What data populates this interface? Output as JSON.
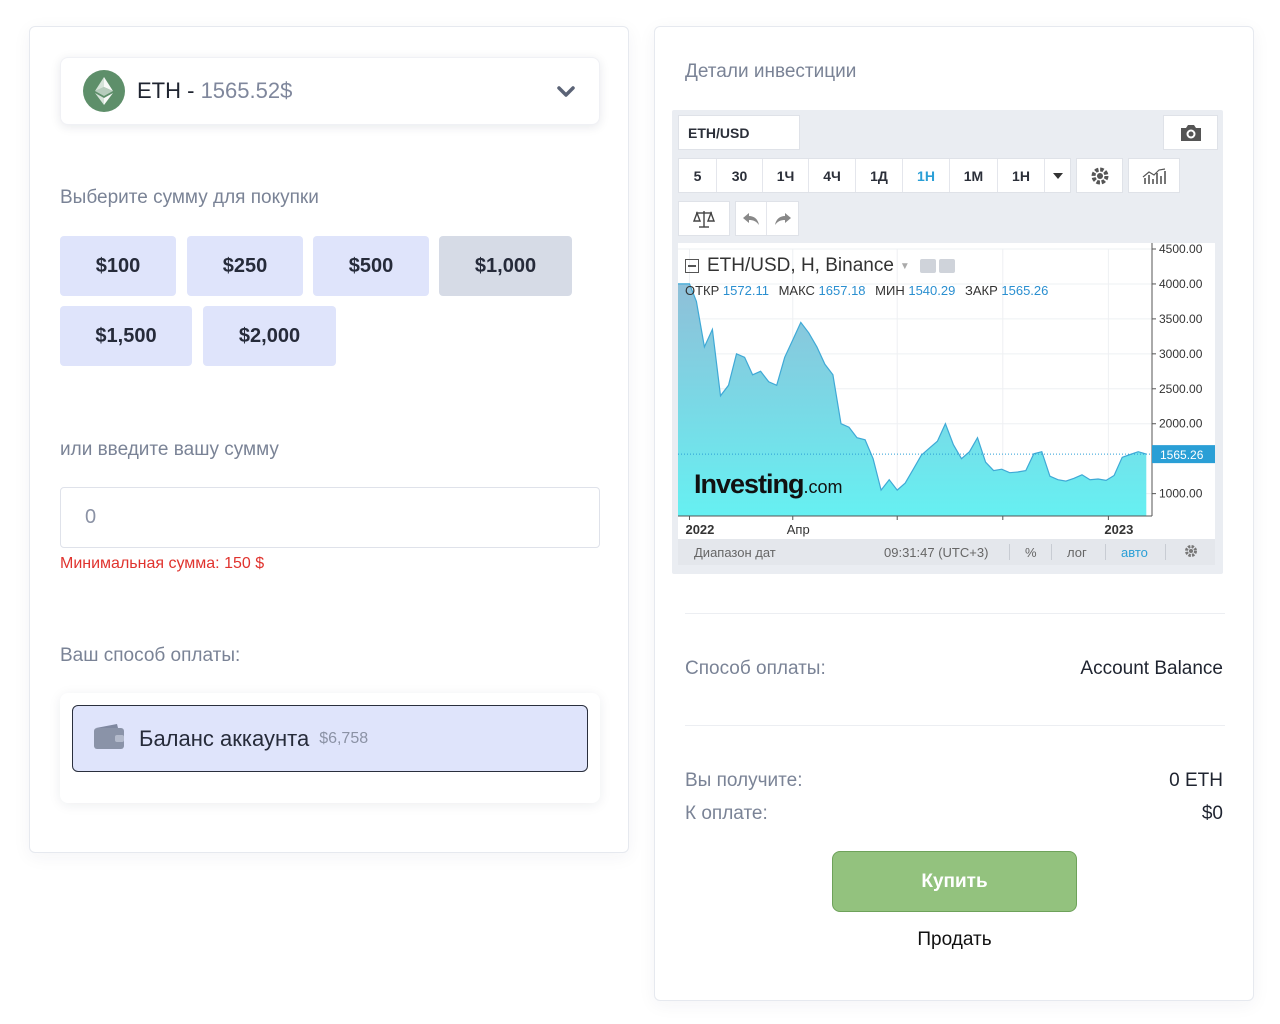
{
  "coin_select": {
    "symbol": "ETH",
    "separator": " - ",
    "price": "1565.52$",
    "icon": "ethereum-icon",
    "dropdown_icon": "chevron-down-icon"
  },
  "amount_section": {
    "label": "Выберите сумму для покупки",
    "presets": [
      {
        "label": "$100",
        "selected": false
      },
      {
        "label": "$250",
        "selected": false
      },
      {
        "label": "$500",
        "selected": false
      },
      {
        "label": "$1,000",
        "selected": true
      },
      {
        "label": "$1,500",
        "selected": false
      },
      {
        "label": "$2,000",
        "selected": false
      }
    ],
    "custom_label": "или введите вашу сумму",
    "custom_value": "0",
    "error": "Минимальная сумма: 150 $"
  },
  "payment_section": {
    "label": "Ваш способ оплаты:",
    "option_label": "Баланс аккаунта",
    "option_balance": "$6,758",
    "option_icon": "wallet-icon"
  },
  "details": {
    "title": "Детали инвестиции",
    "widget": {
      "symbol_input": "ETH/USD",
      "intervals": [
        "5",
        "30",
        "1Ч",
        "4Ч",
        "1Д",
        "1Н",
        "1М",
        "1Н"
      ],
      "active_interval": "1Н",
      "chart_title": "ETH/USD, H, Binance",
      "ohlc": [
        {
          "label": "ОТКР",
          "value": "1572.11"
        },
        {
          "label": "МАКС",
          "value": "1657.18"
        },
        {
          "label": "МИН",
          "value": "1540.29"
        },
        {
          "label": "ЗАКР",
          "value": "1565.26"
        }
      ],
      "watermark_main": "Investing",
      "watermark_suffix": ".com",
      "status": {
        "range": "Диапазон дат",
        "time": "09:31:47 (UTC+3)",
        "percent": "%",
        "log": "лог",
        "auto": "авто"
      },
      "colors": {
        "area_top": "#8fbfd8",
        "area_bottom": "#66f0f2",
        "line": "#3fa9d6",
        "price_tag": "#2a9fd6"
      }
    },
    "payment_label": "Способ оплаты:",
    "payment_value": "Account Balance",
    "receive_label": "Вы получите:",
    "receive_value": "0 ETH",
    "pay_label": "К оплате:",
    "pay_value": "$0",
    "buy_label": "Купить",
    "sell_label": "Продать",
    "buy_color": "#93c27e"
  },
  "chart_data": {
    "type": "area",
    "title": "ETH/USD, H, Binance",
    "xlabel": "",
    "ylabel": "",
    "x_tick_labels": [
      "2022",
      "Апр",
      "2023"
    ],
    "y_tick_labels": [
      "4500.00",
      "4000.00",
      "3500.00",
      "3000.00",
      "2500.00",
      "2000.00",
      "1000.00"
    ],
    "ylim": [
      680,
      4500
    ],
    "last_price_label": "1565.26",
    "grid": true,
    "x": [
      "2022-01-01",
      "2022-01-07",
      "2022-01-14",
      "2022-01-21",
      "2022-01-28",
      "2022-02-04",
      "2022-02-11",
      "2022-02-18",
      "2022-02-25",
      "2022-03-04",
      "2022-03-11",
      "2022-03-18",
      "2022-03-25",
      "2022-04-01",
      "2022-04-08",
      "2022-04-15",
      "2022-04-22",
      "2022-04-29",
      "2022-05-06",
      "2022-05-13",
      "2022-05-20",
      "2022-05-27",
      "2022-06-03",
      "2022-06-10",
      "2022-06-17",
      "2022-06-24",
      "2022-07-01",
      "2022-07-08",
      "2022-07-15",
      "2022-07-22",
      "2022-07-29",
      "2022-08-05",
      "2022-08-12",
      "2022-08-19",
      "2022-08-26",
      "2022-09-02",
      "2022-09-09",
      "2022-09-16",
      "2022-09-23",
      "2022-09-30",
      "2022-10-07",
      "2022-10-14",
      "2022-10-21",
      "2022-10-28",
      "2022-11-04",
      "2022-11-11",
      "2022-11-18",
      "2022-11-25",
      "2022-12-02",
      "2022-12-09",
      "2022-12-16",
      "2022-12-23",
      "2022-12-30",
      "2023-01-06",
      "2023-01-13",
      "2023-01-20",
      "2023-01-27",
      "2023-02-03"
    ],
    "series": [
      {
        "values": [
          4000,
          3750,
          3100,
          3350,
          2400,
          2550,
          3000,
          2950,
          2700,
          2750,
          2600,
          2550,
          2950,
          3200,
          3450,
          3300,
          3100,
          2850,
          2700,
          2000,
          1950,
          1800,
          1770,
          1500,
          1050,
          1200,
          1050,
          1150,
          1350,
          1550,
          1650,
          1750,
          2000,
          1700,
          1500,
          1600,
          1800,
          1450,
          1330,
          1350,
          1300,
          1310,
          1330,
          1570,
          1600,
          1250,
          1200,
          1180,
          1220,
          1270,
          1200,
          1210,
          1190,
          1260,
          1520,
          1560,
          1600,
          1565
        ]
      }
    ]
  }
}
